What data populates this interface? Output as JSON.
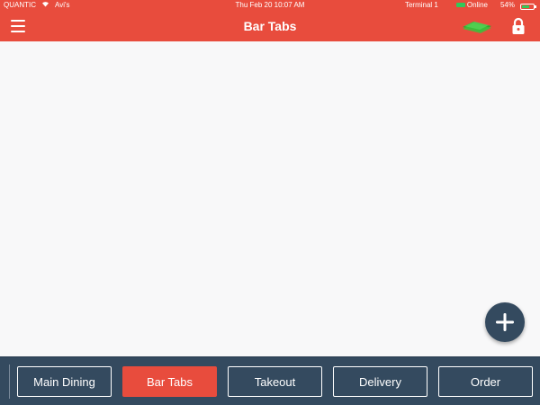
{
  "status_bar": {
    "carrier": "QUANTIC",
    "wifi_name": "Avi's",
    "datetime": "Thu Feb 20 10:07 AM",
    "terminal": "Terminal 1",
    "connection": "Online",
    "battery": "54%",
    "battery_level": 0.54
  },
  "header": {
    "title": "Bar Tabs",
    "menu_icon": "hamburger-menu-icon",
    "cash_icon": "cash-drawer-icon",
    "lock_icon": "lock-icon"
  },
  "fab": {
    "icon": "plus-icon"
  },
  "tabs": [
    {
      "label": "Main Dining",
      "active": false
    },
    {
      "label": "Bar Tabs",
      "active": true
    },
    {
      "label": "Takeout",
      "active": false
    },
    {
      "label": "Delivery",
      "active": false
    },
    {
      "label": "Order",
      "active": false
    }
  ],
  "colors": {
    "brand": "#e84c3d",
    "tabbar": "#344a5f",
    "background": "#f8f8f9"
  }
}
